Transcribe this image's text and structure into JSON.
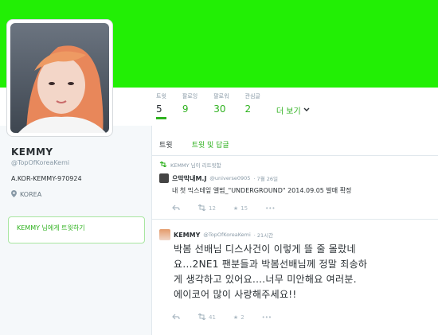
{
  "profile": {
    "name": "KEMMY",
    "handle": "@TopOfKoreaKemi",
    "bio": "A.KOR-KEMMY-970924",
    "location": "KOREA",
    "tweet_to_label": "KEMMY 님에게 트윗하기"
  },
  "stats": [
    {
      "label": "트윗",
      "value": "5"
    },
    {
      "label": "팔로잉",
      "value": "9"
    },
    {
      "label": "팔로워",
      "value": "30"
    },
    {
      "label": "관심글",
      "value": "2"
    }
  ],
  "more_label": "더 보기",
  "tabs": [
    {
      "label": "트윗"
    },
    {
      "label": "트윗 및 답글"
    }
  ],
  "tweet1": {
    "retweet_line": "KEMMY 님이 리트윗함",
    "name": "으막막내M.J",
    "handle": "@universe0905",
    "time": "· 7월 26일",
    "text": "내 첫 믹스테잎 앨범_\"UNDERGROUND\" 2014.09.05 발매 확정",
    "retweets": "12",
    "favorites": "15"
  },
  "tweet2": {
    "name": "KEMMY",
    "handle": "@TopOfKoreaKemi",
    "time": "· 21시간",
    "lines": [
      "박봄 선배님 디스사건이 이렇게 뜰 줄 몰랐네",
      "요...2NE1 팬분들과 박봄선배님께 정말 죄송하",
      "게 생각하고 있어요....너무 미안해요 여러분.",
      "에이코어 많이 사랑해주세요!!"
    ],
    "retweets": "41",
    "favorites": "2"
  },
  "colors": {
    "banner": "#22ef05",
    "accent": "#2fb21f"
  }
}
